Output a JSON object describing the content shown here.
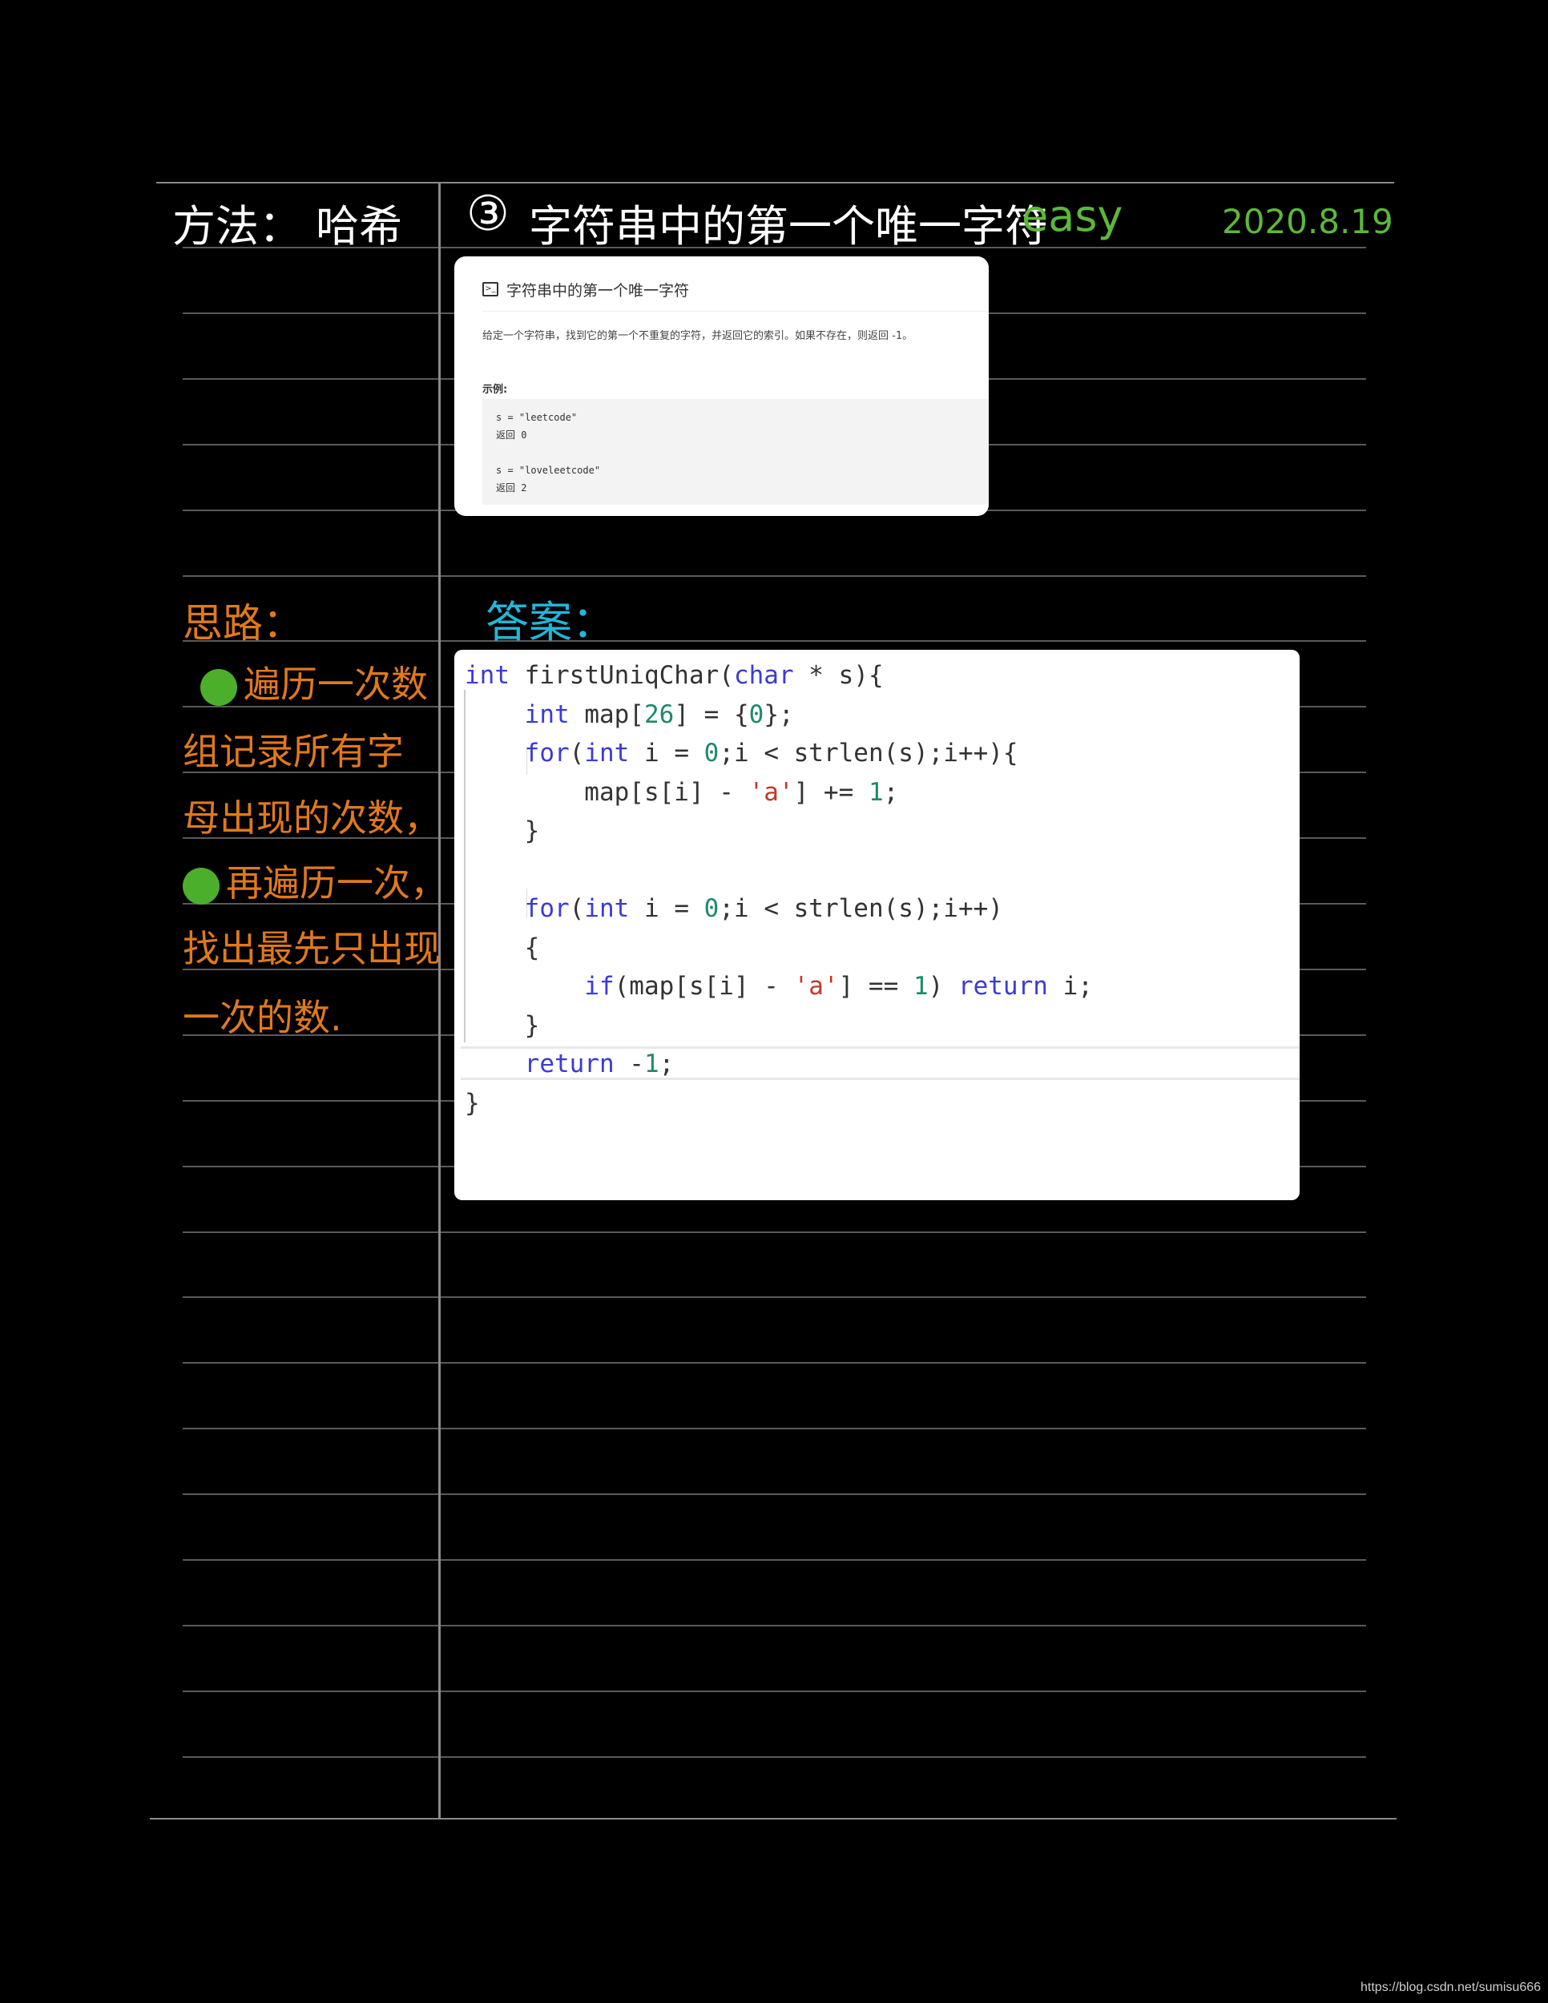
{
  "header": {
    "method": "方法： 哈希",
    "problem_number": "③",
    "problem_title": "字符串中的第一个唯一字符",
    "difficulty": "easy",
    "date": "2020.8.19"
  },
  "problem_card": {
    "icon": "terminal-icon",
    "title": "字符串中的第一个唯一字符",
    "description": "给定一个字符串，找到它的第一个不重复的字符，并返回它的索引。如果不存在，则返回 -1。",
    "example_label": "示例:",
    "examples": [
      {
        "input": "s = \"leetcode\"",
        "output": "返回 0"
      },
      {
        "input": "s = \"loveleetcode\"",
        "output": "返回 2"
      }
    ]
  },
  "notes": {
    "title": "思路：",
    "lines": [
      "遍历一次数",
      "组记录所有字",
      "母出现的次数，",
      "再遍历一次，",
      "找出最先只出现",
      "一次的数."
    ]
  },
  "answer": {
    "title": "答案：",
    "code": [
      "int firstUniqChar(char * s){",
      "    int map[26] = {0};",
      "    for(int i = 0;i < strlen(s);i++){",
      "        map[s[i] - 'a'] += 1;",
      "    }",
      "",
      "    for(int i = 0;i < strlen(s);i++)",
      "    {",
      "        if(map[s[i] - 'a'] == 1) return i;",
      "    }",
      "    return -1;",
      "}"
    ]
  },
  "watermark": "https://blog.csdn.net/sumisu666",
  "colors": {
    "handwriting": "#ffffff",
    "accent_green": "#5cb83a",
    "notes_orange": "#e0791c",
    "answer_cyan": "#22b6d8",
    "keyword": "#3b3bd6",
    "number": "#1e8a6a",
    "string": "#c0392b"
  }
}
